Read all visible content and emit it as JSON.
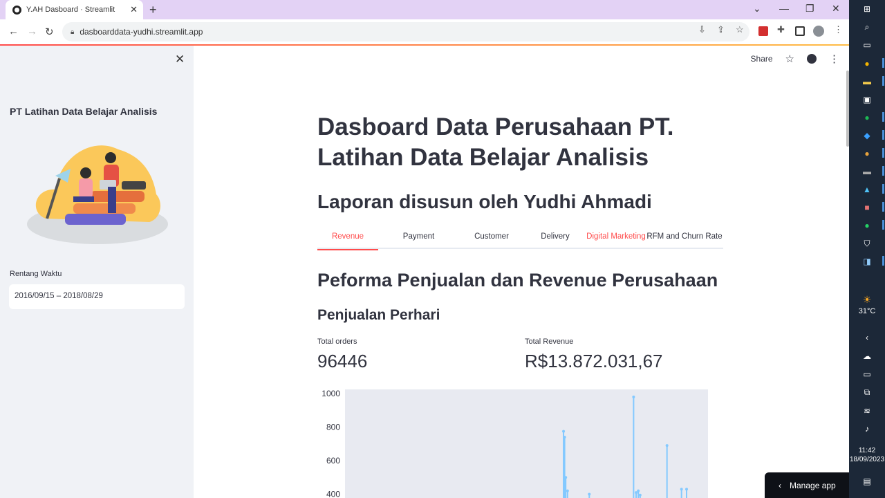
{
  "browser": {
    "tab_title": "Y.AH Dasboard · Streamlit",
    "url": "dasboarddata-yudhi.streamlit.app"
  },
  "app": {
    "share_label": "Share"
  },
  "sidebar": {
    "title": "PT Latihan Data Belajar Analisis",
    "range_label": "Rentang Waktu",
    "range_value": "2016/09/15 – 2018/08/29"
  },
  "main": {
    "title": "Dasboard Data Perusahaan PT. Latihan Data Belajar Analisis",
    "subtitle": "Laporan disusun oleh Yudhi Ahmadi",
    "tabs": [
      {
        "label": "Revenue"
      },
      {
        "label": "Payment"
      },
      {
        "label": "Customer"
      },
      {
        "label": "Delivery"
      },
      {
        "label": "Digital Marketing"
      },
      {
        "label": "RFM and Churn Rate"
      }
    ],
    "section_heading": "Peforma Penjualan dan Revenue Perusahaan",
    "sub_heading": "Penjualan Perhari",
    "metrics": [
      {
        "label": "Total orders",
        "value": "96446"
      },
      {
        "label": "Total Revenue",
        "value": "R$13.872.031,67"
      }
    ]
  },
  "chart_data": {
    "type": "line",
    "y_ticks": [
      "1000",
      "800",
      "600",
      "400"
    ],
    "ylim": [
      360,
      1000
    ],
    "line_color": "#83c9ff",
    "plot_bg": "#e8eaf1",
    "spikes": [
      {
        "x": 0.602,
        "y": 775
      },
      {
        "x": 0.605,
        "y": 740
      },
      {
        "x": 0.608,
        "y": 500
      },
      {
        "x": 0.613,
        "y": 420
      },
      {
        "x": 0.673,
        "y": 400
      },
      {
        "x": 0.795,
        "y": 980
      },
      {
        "x": 0.802,
        "y": 410
      },
      {
        "x": 0.808,
        "y": 420
      },
      {
        "x": 0.813,
        "y": 395
      },
      {
        "x": 0.887,
        "y": 690
      },
      {
        "x": 0.927,
        "y": 430
      },
      {
        "x": 0.941,
        "y": 430
      }
    ]
  },
  "manage_app": {
    "label": "Manage app"
  },
  "taskbar": {
    "temperature": "31°C",
    "time": "11:42",
    "date": "18/09/2023"
  }
}
